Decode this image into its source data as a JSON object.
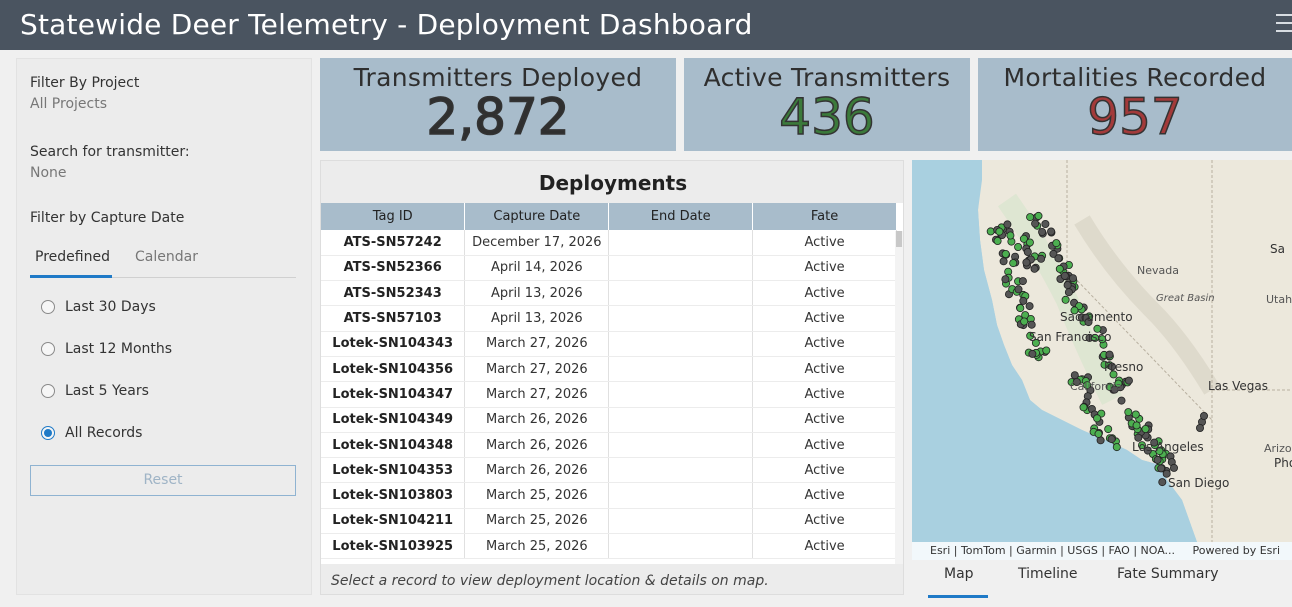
{
  "header": {
    "title": "Statewide Deer Telemetry - Deployment Dashboard",
    "menu_icon": "hamburger-menu-icon"
  },
  "sidebar": {
    "project_label": "Filter By Project",
    "project_value": "All Projects",
    "search_label": "Search for transmitter:",
    "search_value": "None",
    "date_label": "Filter by Capture Date",
    "tabs": [
      "Predefined",
      "Calendar"
    ],
    "options": [
      "Last 30 Days",
      "Last 12 Months",
      "Last 5 Years",
      "All Records"
    ],
    "selected_option": "All Records",
    "reset_label": "Reset"
  },
  "stats": {
    "deployed": {
      "title": "Transmitters Deployed",
      "value": "2,872",
      "color": "#2f2f2f"
    },
    "active": {
      "title": "Active Transmitters",
      "value": "436",
      "color": "#3b7a3b"
    },
    "mortalities": {
      "title": "Mortalities Recorded",
      "value": "957",
      "color": "#a33a3a"
    }
  },
  "table": {
    "title": "Deployments",
    "headers": [
      "Tag ID",
      "Capture Date",
      "End Date",
      "Fate"
    ],
    "rows": [
      [
        "ATS-SN57242",
        "December 17, 2026",
        "",
        "Active"
      ],
      [
        "ATS-SN52366",
        "April 14, 2026",
        "",
        "Active"
      ],
      [
        "ATS-SN52343",
        "April 13, 2026",
        "",
        "Active"
      ],
      [
        "ATS-SN57103",
        "April 13, 2026",
        "",
        "Active"
      ],
      [
        "Lotek-SN104343",
        "March 27, 2026",
        "",
        "Active"
      ],
      [
        "Lotek-SN104356",
        "March 27, 2026",
        "",
        "Active"
      ],
      [
        "Lotek-SN104347",
        "March 27, 2026",
        "",
        "Active"
      ],
      [
        "Lotek-SN104349",
        "March 26, 2026",
        "",
        "Active"
      ],
      [
        "Lotek-SN104348",
        "March 26, 2026",
        "",
        "Active"
      ],
      [
        "Lotek-SN104353",
        "March 26, 2026",
        "",
        "Active"
      ],
      [
        "Lotek-SN103803",
        "March 25, 2026",
        "",
        "Active"
      ],
      [
        "Lotek-SN104211",
        "March 25, 2026",
        "",
        "Active"
      ],
      [
        "Lotek-SN103925",
        "March 25, 2026",
        "",
        "Active"
      ]
    ],
    "footer": "Select a record to view deployment location & details on map."
  },
  "map": {
    "labels": {
      "nevada": "Nevada",
      "great_basin": "Great Basin",
      "utah": "Utah",
      "sacramento": "Sacramento",
      "san_francisco": "San Francisco",
      "fresno": "Fresno",
      "california": "California",
      "las_vegas": "Las Vegas",
      "los_angeles": "Los Angeles",
      "san_diego": "San Diego",
      "arizona": "Arizona",
      "phoenix": "Phoenix",
      "salt_lake": "Sa"
    },
    "attribution": "Esri | TomTom | Garmin | USGS | FAO | NOA...",
    "powered_by": "Powered by Esri",
    "tabs": [
      "Map",
      "Timeline",
      "Fate Summary"
    ],
    "active_tab": "Map",
    "colors": {
      "active_point": "#4caf50",
      "mortality_point": "#555555",
      "ocean": "#a9d0e0",
      "land": "#e9e4d8"
    }
  }
}
